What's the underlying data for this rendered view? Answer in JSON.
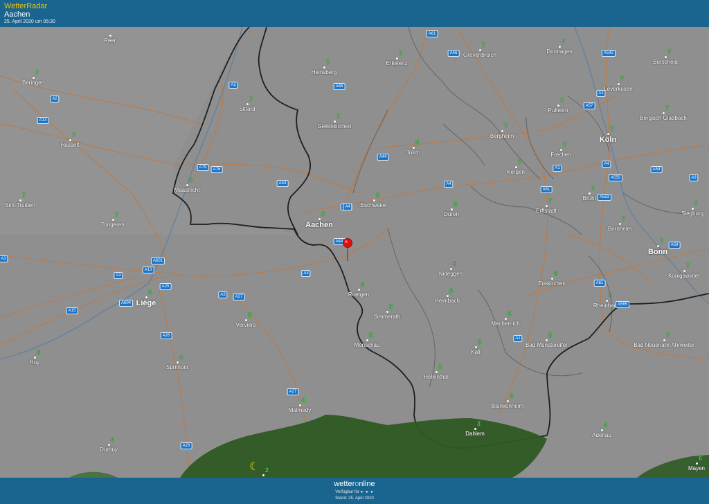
{
  "header": {
    "brand": "WetterRadar",
    "location": "Aachen",
    "timestamp": "25. April 2020 um 05:30"
  },
  "footer": {
    "logo_prefix": "wetter",
    "logo_o": "o",
    "logo_suffix": "nline",
    "availability": "Verfügbar für",
    "asof": "Stand: 25. April 2020"
  },
  "colors": {
    "bar": "#1a6590",
    "map_gray": "#8e8e8e",
    "road": "#c7773a",
    "border": "#222222",
    "temp_text": "#3ed13e",
    "forest": "#2d5a23",
    "pin": "#e01010"
  },
  "marker": {
    "icon": "location-pin-icon",
    "place": "Aachen"
  },
  "moon_icon": "crescent-moon-icon",
  "cities": [
    {
      "name": "Peer",
      "t": ""
    },
    {
      "name": "Beringen",
      "t": "7"
    },
    {
      "name": "Hasselt",
      "t": "7"
    },
    {
      "name": "Sint-Truiden",
      "t": "7"
    },
    {
      "name": "Tongeren",
      "t": "7"
    },
    {
      "name": "Maastricht",
      "t": "6"
    },
    {
      "name": "Sittard",
      "t": "7"
    },
    {
      "name": "Heinsberg",
      "t": "7"
    },
    {
      "name": "Geilenkirchen",
      "t": "7"
    },
    {
      "name": "Erkelenz",
      "t": "7"
    },
    {
      "name": "Grevenbroich",
      "t": "7"
    },
    {
      "name": "Dormagen",
      "t": "7"
    },
    {
      "name": "Burscheid",
      "t": "7"
    },
    {
      "name": "Leverkusen",
      "t": "7"
    },
    {
      "name": "Pulheim",
      "t": "7"
    },
    {
      "name": "Bergisch Gladbach",
      "t": "7"
    },
    {
      "name": "Köln",
      "t": "7"
    },
    {
      "name": "Bergheim",
      "t": "7"
    },
    {
      "name": "Frechen",
      "t": "7"
    },
    {
      "name": "Jülich",
      "t": "6"
    },
    {
      "name": "Kerpen",
      "t": "7"
    },
    {
      "name": "Eschweiler",
      "t": "6"
    },
    {
      "name": "Aachen",
      "t": "6"
    },
    {
      "name": "Düren",
      "t": "6"
    },
    {
      "name": "Erftstadt",
      "t": "7"
    },
    {
      "name": "Brühl",
      "t": "7"
    },
    {
      "name": "Siegburg",
      "t": "7"
    },
    {
      "name": "Bornheim",
      "t": "7"
    },
    {
      "name": "Bonn",
      "t": "7"
    },
    {
      "name": "Königswinter",
      "t": "7"
    },
    {
      "name": "Nideggen",
      "t": "6"
    },
    {
      "name": "Euskirchen",
      "t": "6"
    },
    {
      "name": "Roetgen",
      "t": "5"
    },
    {
      "name": "Heimbach",
      "t": "6"
    },
    {
      "name": "Rheinbach",
      "t": "6"
    },
    {
      "name": "Liège",
      "t": "6"
    },
    {
      "name": "Verviers",
      "t": "5"
    },
    {
      "name": "Simmerath",
      "t": "5"
    },
    {
      "name": "Mechernich",
      "t": "5"
    },
    {
      "name": "Monschau",
      "t": "5"
    },
    {
      "name": "Kall",
      "t": "5"
    },
    {
      "name": "Bad Münstereifel",
      "t": "6"
    },
    {
      "name": "Bad Neuenahr-Ahrweiler",
      "t": "7"
    },
    {
      "name": "Huy",
      "t": "6"
    },
    {
      "name": "Sprimont",
      "t": "4"
    },
    {
      "name": "Hellenthal",
      "t": "3"
    },
    {
      "name": "Blankenheim",
      "t": "3"
    },
    {
      "name": "Malmedy",
      "t": "4"
    },
    {
      "name": "Dahlem",
      "t": "3"
    },
    {
      "name": "Adenau",
      "t": "4"
    },
    {
      "name": "Durbuy",
      "t": "4"
    },
    {
      "name": "Mayen",
      "t": "6"
    },
    {
      "name": "",
      "t": "2"
    }
  ],
  "roads": [
    "A61",
    "A46",
    "A542",
    "A1",
    "A57",
    "A2",
    "A46",
    "A13",
    "A2",
    "A79",
    "A76",
    "A44",
    "A4",
    "A61",
    "A4",
    "A59",
    "A555",
    "A553",
    "A1",
    "A61",
    "A3",
    "A3",
    "A601",
    "A13",
    "A3",
    "A25",
    "A3",
    "A27",
    "A604",
    "A15",
    "A26",
    "A27",
    "A26",
    "A1",
    "A565",
    "A61",
    "A59",
    "A4",
    "A3",
    "A44",
    "A4",
    "A44",
    "A3"
  ]
}
